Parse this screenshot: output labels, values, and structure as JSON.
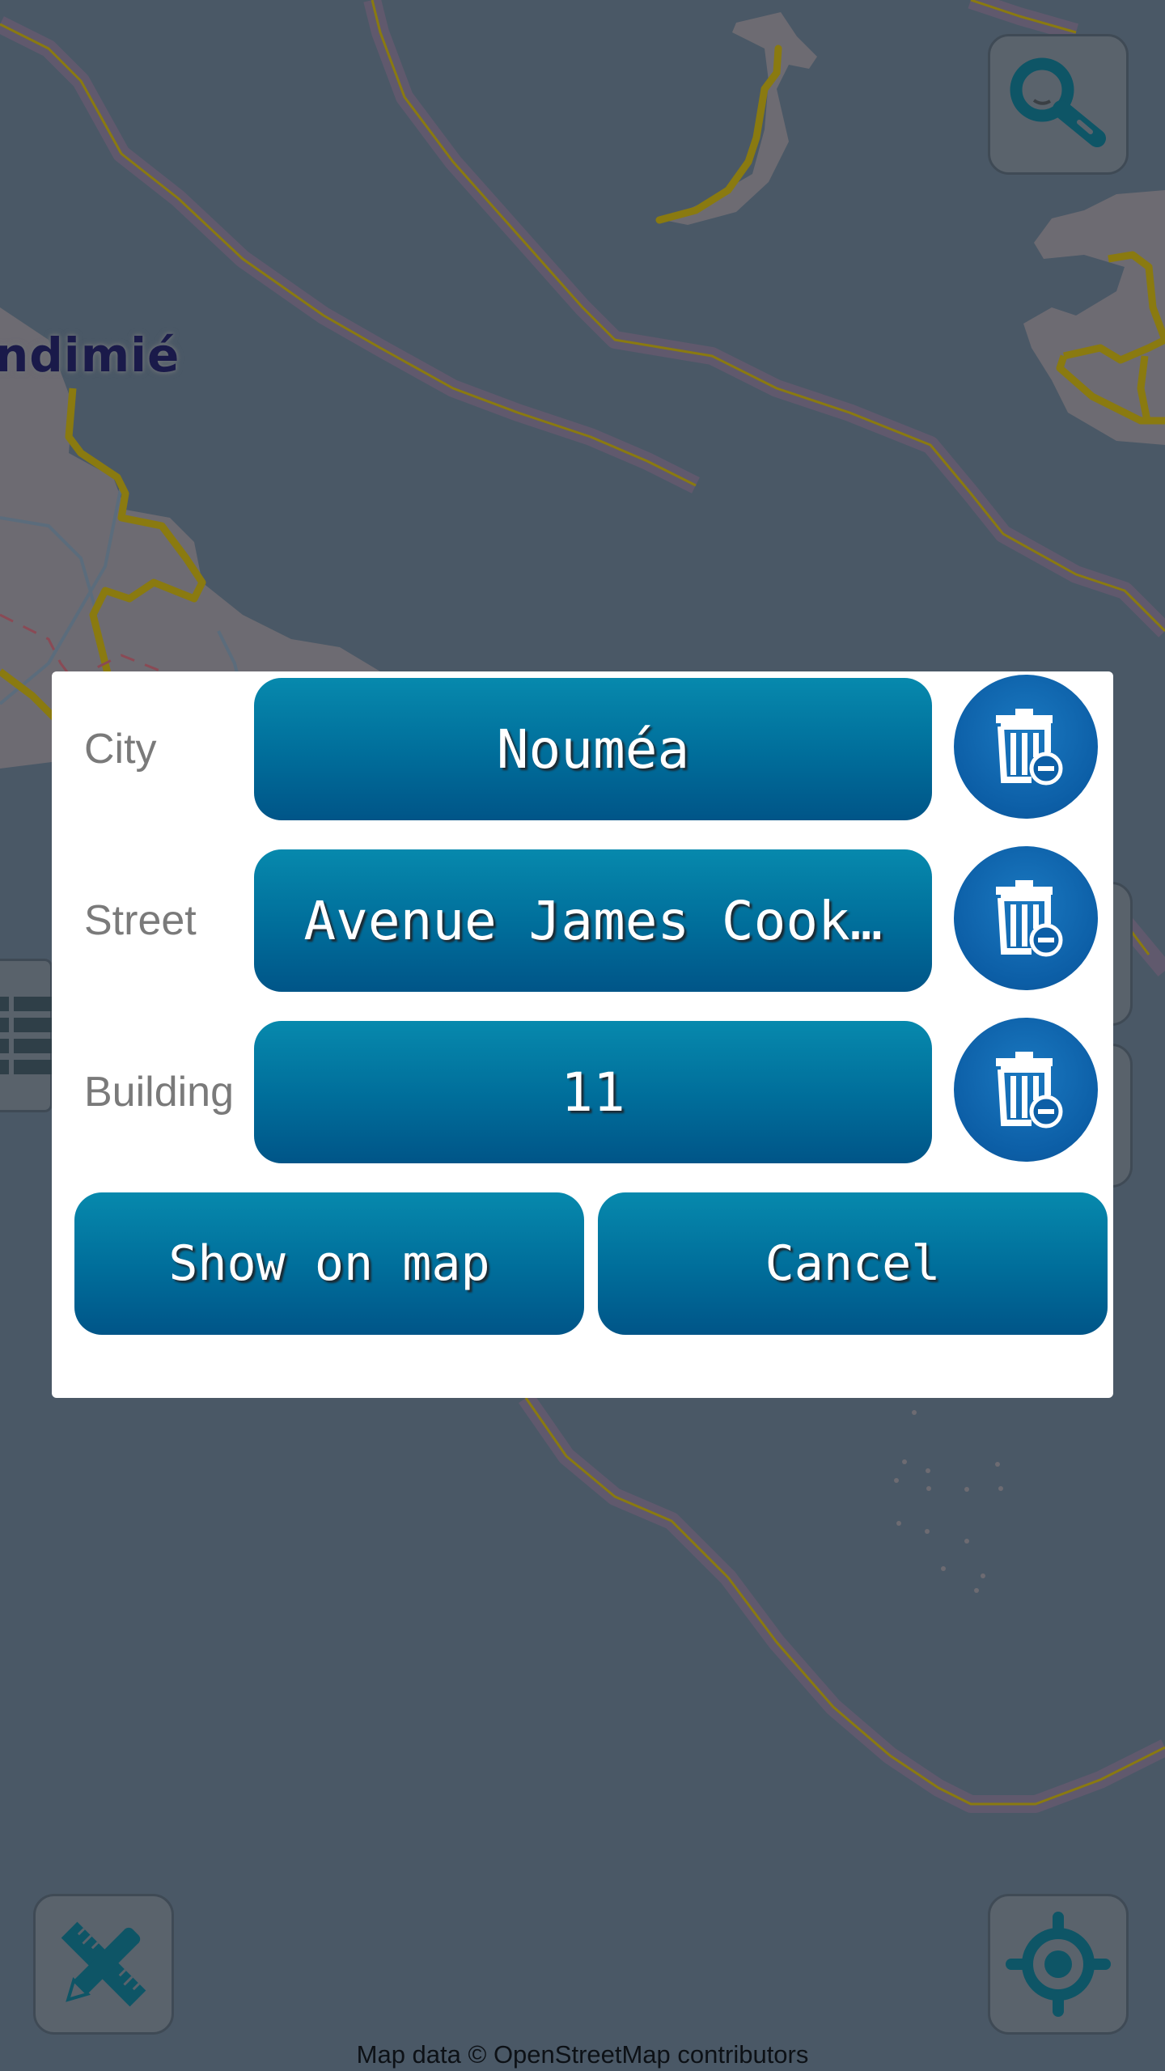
{
  "map": {
    "place_label": "ndimié",
    "attribution": "Map data © OpenStreetMap contributors",
    "colors": {
      "water": "#4a5866",
      "land": "#6d6b72",
      "road": "#8a7a10",
      "border_halo": "#6a5a70"
    }
  },
  "controls": {
    "search_icon": "search-icon",
    "ruler_pencil_icon": "ruler-pencil-icon",
    "locate_icon": "locate-icon"
  },
  "dialog": {
    "rows": [
      {
        "label": "City",
        "value": "Nouméa"
      },
      {
        "label": "Street",
        "value": "Avenue James Cook…"
      },
      {
        "label": "Building",
        "value": "11"
      }
    ],
    "clear_icon": "trash-minus-icon",
    "show_on_map_label": "Show on map",
    "cancel_label": "Cancel",
    "accent_color": "#006d9a"
  }
}
